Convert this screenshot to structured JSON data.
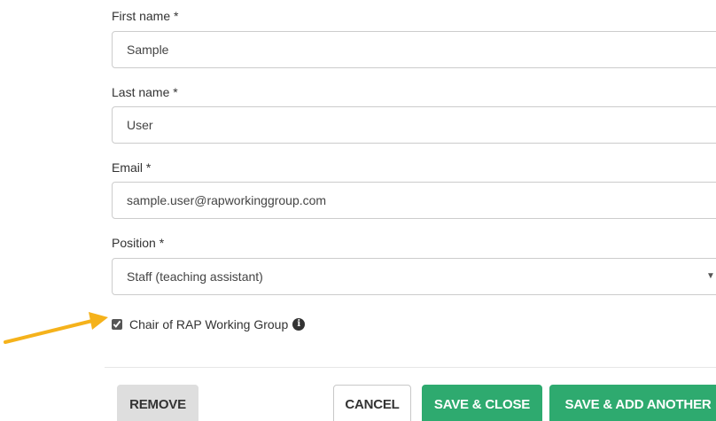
{
  "form": {
    "first_name": {
      "label": "First name *",
      "value": "Sample"
    },
    "last_name": {
      "label": "Last name *",
      "value": "User"
    },
    "email": {
      "label": "Email *",
      "value": "sample.user@rapworkinggroup.com"
    },
    "position": {
      "label": "Position *",
      "value": "Staff (teaching assistant)"
    },
    "chair_checkbox": {
      "label": "Chair of RAP Working Group",
      "checked": true
    }
  },
  "actions": {
    "remove": "REMOVE",
    "cancel": "CANCEL",
    "save_close": "SAVE & CLOSE",
    "save_add_another": "SAVE & ADD ANOTHER"
  },
  "icons": {
    "info": "info-icon",
    "dropdown": "caret-down-icon",
    "pointer": "arrow-annotation-icon"
  },
  "colors": {
    "primary_green": "#2eaa6f",
    "remove_gray": "#dedede",
    "annotation_arrow": "#f5b21b"
  }
}
